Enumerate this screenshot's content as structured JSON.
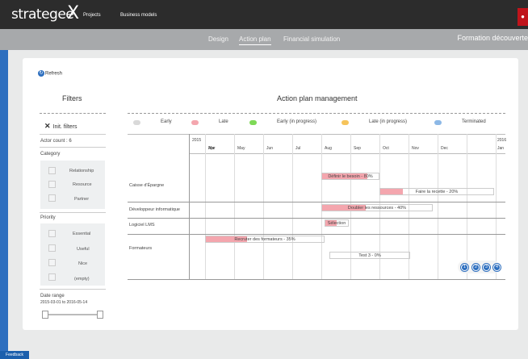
{
  "app": {
    "logo": "strategee",
    "logo_x": "X",
    "nav": [
      "Projects",
      "Business models"
    ]
  },
  "tabs": [
    "Design",
    "Action plan",
    "Financial simulation"
  ],
  "project_title": "Formation découverte",
  "refresh_label": "Refresh",
  "filters": {
    "title": "Filters",
    "init_label": "Init. filters",
    "actor_count_label": "Actor count : 6",
    "category_label": "Category",
    "categories": [
      "Relationship",
      "Resource",
      "Partner"
    ],
    "priority_label": "Priority",
    "priorities": [
      "Essential",
      "Useful",
      "Nice",
      "(empty)"
    ],
    "date_range_label": "Date range",
    "date_range_value": "2015-03-01 to 2016-05-14"
  },
  "plan": {
    "title": "Action plan management",
    "legend": [
      {
        "label": "Early",
        "color": "#d9d9d9"
      },
      {
        "label": "Late",
        "color": "#f4a6ae"
      },
      {
        "label": "Early (in progress)",
        "color": "#7ed957"
      },
      {
        "label": "Late (in progress)",
        "color": "#f6c45b"
      },
      {
        "label": "Terminated",
        "color": "#8cb8e6"
      }
    ],
    "year_left": "2015",
    "year_right": "2016",
    "months": [
      "Mar",
      "Apr",
      "May",
      "Jun",
      "Jul",
      "Aug",
      "Sep",
      "Oct",
      "Nov",
      "Dec",
      "Jan"
    ],
    "rows": [
      "Caisse d'Épargne",
      "Développeur informatique",
      "Logiciel LMS",
      "Formateurs"
    ],
    "bars": [
      {
        "label": "Définir le besoin - 80%",
        "progress": 0.8
      },
      {
        "label": "Faire la recette - 20%",
        "progress": 0.2
      },
      {
        "label": "Doubler les ressources - 40%",
        "progress": 0.4
      },
      {
        "label": "Sélection",
        "progress": 0.5
      },
      {
        "label": "Recruter des formateurs - 35%",
        "progress": 0.35
      },
      {
        "label": "Test 3 - 0%",
        "progress": 0
      }
    ],
    "pager": [
      "1",
      "2",
      "3",
      "4"
    ]
  },
  "feedback_label": "Feedback",
  "colors": {
    "accent": "#2e6fbf",
    "late": "#f4a6ae",
    "topbar": "#2c2c2c"
  }
}
